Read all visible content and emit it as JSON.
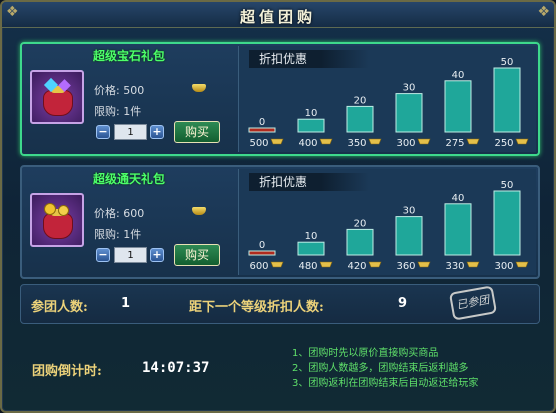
{
  "window": {
    "title": "超值团购",
    "close_label": "×"
  },
  "packages": [
    {
      "name": "超级宝石礼包",
      "icon": "gem-gift-bag-icon",
      "price_text": "价格: 500",
      "limit_text": "限购: 1件",
      "quantity": "1",
      "buy_label": "购买",
      "discount_title": "折扣优惠",
      "tiers": [
        {
          "people": "0",
          "price": "500",
          "fill": 0.06
        },
        {
          "people": "10",
          "price": "400",
          "fill": 0.2
        },
        {
          "people": "20",
          "price": "350",
          "fill": 0.4
        },
        {
          "people": "30",
          "price": "300",
          "fill": 0.6
        },
        {
          "people": "40",
          "price": "275",
          "fill": 0.8
        },
        {
          "people": "50",
          "price": "250",
          "fill": 1.0
        }
      ]
    },
    {
      "name": "超级通天礼包",
      "icon": "coin-gift-bag-icon",
      "price_text": "价格: 600",
      "limit_text": "限购: 1件",
      "quantity": "1",
      "buy_label": "购买",
      "discount_title": "折扣优惠",
      "tiers": [
        {
          "people": "0",
          "price": "600",
          "fill": 0.06
        },
        {
          "people": "10",
          "price": "480",
          "fill": 0.2
        },
        {
          "people": "20",
          "price": "420",
          "fill": 0.4
        },
        {
          "people": "30",
          "price": "360",
          "fill": 0.6
        },
        {
          "people": "40",
          "price": "330",
          "fill": 0.8
        },
        {
          "people": "50",
          "price": "300",
          "fill": 1.0
        }
      ]
    }
  ],
  "status": {
    "joined_label": "参团人数:",
    "joined_value": "1",
    "next_label": "距下一个等级折扣人数:",
    "next_value": "9",
    "stamp_text": "已参团"
  },
  "countdown": {
    "label": "团购倒计时:",
    "value": "14:07:37"
  },
  "rules": [
    "1、团购时先以原价直接购买商品",
    "2、团购人数越多，团购结束后返利越多",
    "3、团购返利在团购结束后自动返还给玩家"
  ],
  "colors": {
    "active_border": "#3ed98c",
    "first_tier_bar": "#b02a1e",
    "tier_bar": "#1fa79a",
    "gold": "#ecd27a",
    "rule_text": "#5fe06a"
  }
}
